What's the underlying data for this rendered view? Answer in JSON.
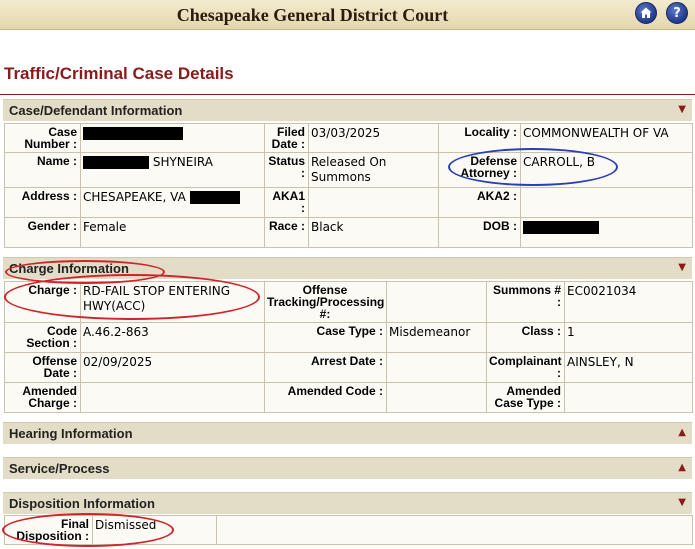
{
  "header": {
    "title": "Chesapeake General District Court",
    "home_icon": "home-icon",
    "help_label": "?"
  },
  "page_title": "Traffic/Criminal Case Details",
  "sections": {
    "case": {
      "title": "Case/Defendant Information",
      "arrow": "▼",
      "case_number_label": "Case Number :",
      "filed_date_label": "Filed Date :",
      "filed_date": "03/03/2025",
      "locality_label": "Locality :",
      "locality": "COMMONWEALTH OF VA",
      "name_label": "Name :",
      "name_suffix": "SHYNEIRA",
      "status_label": "Status :",
      "status": "Released On Summons",
      "defense_attorney_label": "Defense Attorney :",
      "defense_attorney": "CARROLL, B",
      "address_label": "Address :",
      "address": "CHESAPEAKE, VA",
      "aka1_label": "AKA1 :",
      "aka2_label": "AKA2 :",
      "gender_label": "Gender :",
      "gender": "Female",
      "race_label": "Race :",
      "race": "Black",
      "dob_label": "DOB :"
    },
    "charge": {
      "title": "Charge Information",
      "arrow": "▼",
      "charge_label": "Charge :",
      "charge": "RD-FAIL STOP ENTERING HWY(ACC)",
      "offense_tracking_label": "Offense Tracking/Processing #:",
      "summons_label": "Summons # :",
      "summons": "EC0021034",
      "code_section_label": "Code Section :",
      "code_section": "A.46.2-863",
      "case_type_label": "Case Type :",
      "case_type": "Misdemeanor",
      "class_label": "Class :",
      "class_value": "1",
      "offense_date_label": "Offense Date :",
      "offense_date": "02/09/2025",
      "arrest_date_label": "Arrest Date :",
      "complainant_label": "Complainant :",
      "complainant": "AINSLEY, N",
      "amended_charge_label": "Amended Charge :",
      "amended_code_label": "Amended Code :",
      "amended_case_type_label": "Amended Case Type :"
    },
    "hearing": {
      "title": "Hearing Information",
      "arrow": "▲"
    },
    "service": {
      "title": "Service/Process",
      "arrow": "▲"
    },
    "disposition": {
      "title": "Disposition Information",
      "arrow": "▼",
      "final_disposition_label": "Final Disposition :",
      "final_disposition": "Dismissed"
    }
  },
  "colors": {
    "accent_red": "#8b1a1a",
    "annotation_red": "#d1232a",
    "annotation_blue": "#2a3fb5",
    "header_bg": "#e3dcc6"
  }
}
